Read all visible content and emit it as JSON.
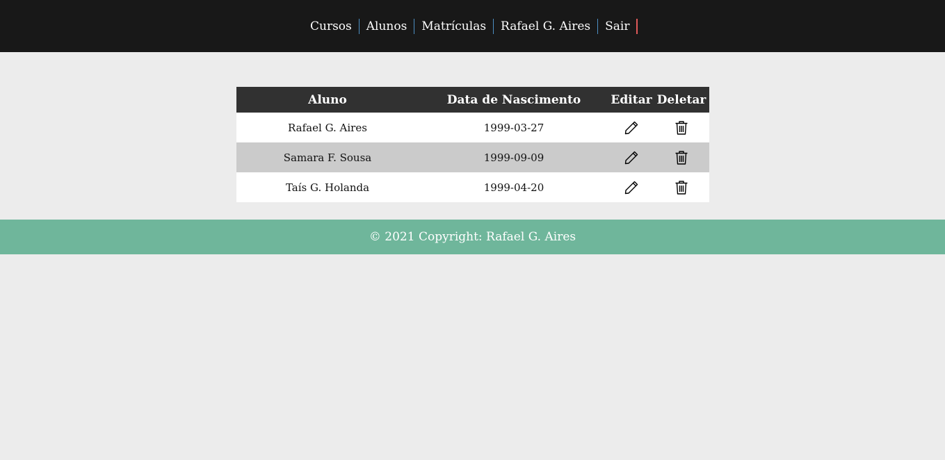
{
  "nav": {
    "items": [
      {
        "label": "Cursos"
      },
      {
        "label": "Alunos"
      },
      {
        "label": "Matrículas"
      },
      {
        "label": "Rafael G. Aires"
      },
      {
        "label": "Sair"
      }
    ],
    "accent_color": "#4d8fc4",
    "logout_accent_color": "#e05a5a"
  },
  "table": {
    "headers": [
      "Aluno",
      "Data de Nascimento",
      "Editar",
      "Deletar"
    ],
    "rows": [
      {
        "aluno": "Rafael G. Aires",
        "nascimento": "1999-03-27",
        "edit_icon": "pencil-icon",
        "delete_icon": "trash-icon"
      },
      {
        "aluno": "Samara F. Sousa",
        "nascimento": "1999-09-09",
        "edit_icon": "pencil-icon",
        "delete_icon": "trash-icon"
      },
      {
        "aluno": "Taís G. Holanda",
        "nascimento": "1999-04-20",
        "edit_icon": "pencil-icon",
        "delete_icon": "trash-icon"
      }
    ]
  },
  "footer": {
    "text": "© 2021 Copyright: Rafael G. Aires",
    "color": "#6fb69b"
  }
}
